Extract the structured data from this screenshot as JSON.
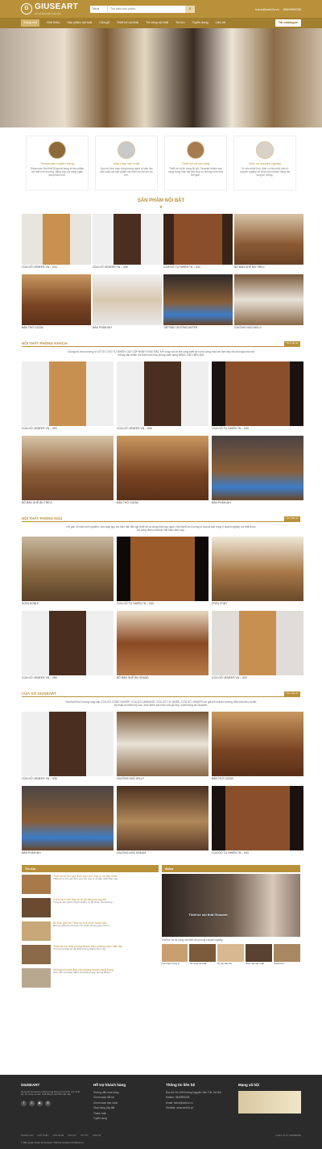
{
  "header": {
    "logo_text": "GIUSEART",
    "logo_tag": "ĐỒ GỖ NỘI THẤT CAO CẤP",
    "search_category": "Tất cả",
    "search_placeholder": "Tìm kiếm sản phẩm...",
    "email": "hotro@web2v.vn",
    "phone": "0849999295"
  },
  "nav": {
    "items": [
      "Trang chủ",
      "Giới thiệu",
      "Sản phẩm nội thất",
      "Cửa gỗ",
      "Thiết kế nội thất",
      "Thi công nội thất",
      "Tin tức",
      "Tuyển dụng",
      "Liên hệ"
    ],
    "catalog": "Tải catalogue"
  },
  "features": [
    {
      "title": "Showroom hoành tráng",
      "desc": "Showroom Nội thất Giuseart trang bị sản phẩm nội thất thời thượng, đẳng cấp với hàng ngàn sản phẩm mới."
    },
    {
      "title": "Nhà máy sản xuất",
      "desc": "Quy mô nhà máy công lượng nghệ ni hiện đại sản xuất các sản phẩm nội thất cho các dự án lớn."
    },
    {
      "title": "Thiết kế và thi công",
      "desc": "Thiết kế và thi công đồ gỗ, Giuseart khách sạn sang trọng hiện đại bắt nhịp xu hướng mới nhất thế giới."
    },
    {
      "title": "Dịch vụ chuyên nghiệp",
      "desc": "Tư vấn nhiệt tình, dịch vụ hậu mãi, bảo trì chuyên nghiệp sẽ khiến mọi khách hàng hài lòng tin tưởng."
    }
  ],
  "featured": {
    "title": "SẢN PHẨM NỔI BẬT",
    "items": [
      "CỬA GỖ VENEER VN – 003",
      "CỬA GỖ VENEER VN – 006",
      "CỬA GỖ TỰ NHIÊN TN – 043",
      "BỘ BÀN GHẾ ĂN TREVI",
      "BÀN THỜ G023A",
      "BÀN PHẤN AIH",
      "TẬP ĐẦU GIƯỜNG ANTER",
      "GIƯỜNG NGỦ KELLY"
    ]
  },
  "sections": [
    {
      "title": "NỘI THẤT PHÒNG KHÁCH",
      "more": "Xem tất cả",
      "desc": "Chúng tôi, theo hướng từ GỖ ÓC CHÓ TỰ NHIÊN CAO CẤP NHẬP KHẨU ĐẮC MỸ cùng với lợi thế công thiết kế và thi công, nâu hơi làm đẹp cho bồi ngôi nhà với những sản phẩm nội thất hoàn hảo phong cách sang ĐẲNG CẤP HIỆN ĐẠI.",
      "items": [
        "CỬA GỖ VENEER VN – 003",
        "CỬA GỖ VENEER VN – 006",
        "CỬA GỖ TỰ NHIÊN TN – 043",
        "BỘ BÀN GHẾ ĂN TREVI",
        "BÀN THỜ G023A",
        "BÀN PHẤN AIH"
      ]
    },
    {
      "title": "NỘI THẤT PHÒNG NGỦ",
      "more": "Xem tất cả",
      "desc": "Với gần 20 năm kinh nghiệm, nhà máy quy mô hiện đại, đội ngũ thiết kế và công nhân tay nghề, Nội thất Đức Dương tự hào là một trong 5 doanh nghiệp nội thất được tin dùng nhiều nhất tại Việt Nam hiện nay.",
      "items": [
        "SOFA NOBLE",
        "CỬA GỖ TỰ NHIÊN TN – 033",
        "SOFA COBY",
        "CỬA GỖ VENEER VN – 006",
        "BỘ BÀN GHẾ ĂN GRAND",
        "CỬA GỖ VENEER VN – 003"
      ]
    },
    {
      "title": "CỬA GỖ GIUSEART",
      "more": "Xem tất cả",
      "desc": "Nội thất Đức Dương cung cấp CỬA GỖ CÔNG NGHIỆP, CỬA GỖ LAMINATE, CỬA GỖ TỰ NHIÊN, CỬA GỖ VENEER với giá tốt nhất thị trường, đảm bảo tiêu chuẩn kỹ thuật và thẩm mỹ cao. Xem thêm các mẫu cửa gỗ đẹp, chất lượng tại Giuseart.",
      "items": [
        "CỬA GỖ VENEER VN – 006",
        "GIƯỜNG NGỦ KELLY",
        "BÀN THỜ G023A",
        "BÀN PHẤN AIH",
        "GIƯỜNG NGỦ DREAM",
        "CỬA GỖ TỰ NHIÊN TN – 043"
      ]
    }
  ],
  "news": {
    "title": "Tin tức",
    "items": [
      {
        "title": "Thiết kế tủ thờ gia đình sao cho hợp lý và đẹp nhất",
        "snippet": "Thiết kế tủ thờ gia đình sao cho hợp lý và đẹp nhất hiện nay..."
      },
      {
        "title": "5 khu vực nên bày trí tủ gỗ tăng vượng khí",
        "snippet": "Từng là sản phẩm truyền thống, tủ gỗ được ưa chuộng..."
      },
      {
        "title": "Bộ bàn ghế ăn Trevi sự lựa chọn hoàn hảo",
        "snippet": "Bộ bàn ghế ăn phù hợp cho nhiều không gian nhà ở..."
      },
      {
        "title": "Thiết kế nội thất phòng khách theo phong cách hiện đại",
        "snippet": "Xu hướng thiết kế nội thất phòng khách năm nay..."
      },
      {
        "title": "Những bộ sofa đẹp cho phòng khách sang trọng",
        "snippet": "Các mẫu sofa đẹp dành cho không gian phòng khách..."
      }
    ]
  },
  "video": {
    "title": "Video",
    "overlay": "Thiết kế nội thất Giuseart",
    "caption": "Thiết kế và thi công nội thất văn phòng chuyên nghiệp",
    "thumbs": [
      "Giới thiệu Công ty",
      "Thi công nội thất",
      "Dự án biệt thự",
      "Nhà máy sản xuất",
      "Showroom"
    ]
  },
  "footer": {
    "logo_text": "GIUSEART",
    "about": "Giuseart là doanh nghiệp hoạt động trong lĩnh vực thiết kế, thi công và sản xuất đồ gỗ nội thất cao cấp.",
    "col_support_title": "Hỗ trợ khách hàng",
    "col_support": [
      "Hướng dẫn mua hàng",
      "Chính sách đổi trả",
      "Chính sách bảo hành",
      "Giao hàng, lắp đặt",
      "Thanh toán",
      "Tuyển dụng"
    ],
    "col_contact_title": "Thông tin liên hệ",
    "col_contact": [
      "Địa chỉ: Số 109 Đường Nguyễn Văn Trỗi, Hà Nội",
      "Hotline: 0849999295",
      "Email: hotro@web2v.vn",
      "Website: www.web2v.vn"
    ],
    "col_social_title": "Mạng xã hội",
    "links": [
      "TRANG CHỦ",
      "GIỚI THIỆU",
      "SẢN PHẨM",
      "CỬA GỖ",
      "TIN TỨC",
      "LIÊN HỆ"
    ],
    "copyright": "© Bản quyền thuộc về Giuseart. Thiết kế website bởi Web2v.vn",
    "right": "Hotline hỗ trợ: 0849999295"
  }
}
